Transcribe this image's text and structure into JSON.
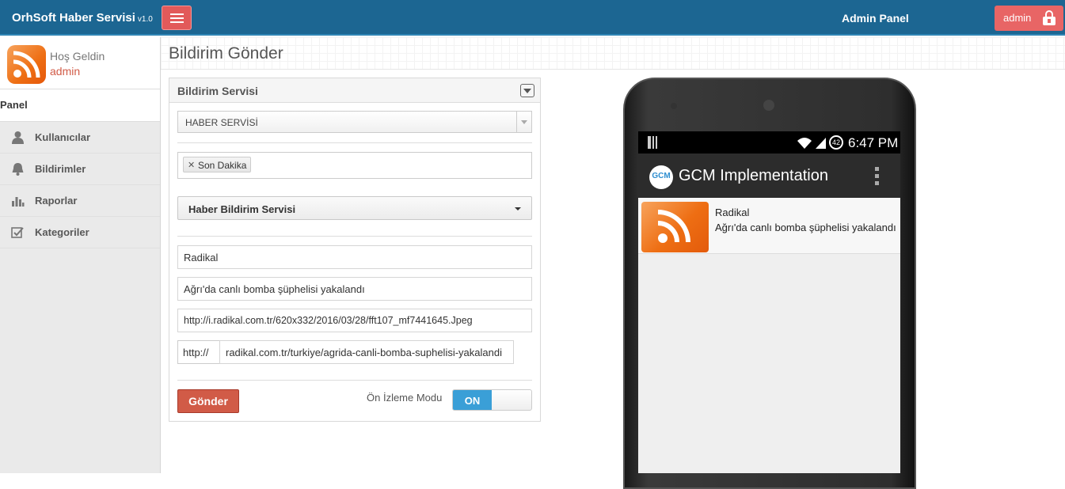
{
  "navbar": {
    "brand": "OrhSoft Haber Servisi",
    "version": "v1.0",
    "center_title": "Admin Panel",
    "user_button": "admin",
    "accent": "#1c6692"
  },
  "sidebar": {
    "greeting": "Hoş Geldin",
    "username": "admin",
    "section": "Panel",
    "items": [
      {
        "label": "Kullanıcılar",
        "icon": "user-icon"
      },
      {
        "label": "Bildirimler",
        "icon": "bell-icon"
      },
      {
        "label": "Raporlar",
        "icon": "bar-chart-icon"
      },
      {
        "label": "Kategoriler",
        "icon": "checkbox-icon"
      }
    ]
  },
  "page": {
    "title": "Bildirim Gönder"
  },
  "form": {
    "widget_title": "Bildirim Servisi",
    "service_select": "HABER SERVİSİ",
    "tag": "Son Dakika",
    "dropdown": "Haber Bildirim Servisi",
    "source": "Radikal",
    "headline": "Ağrı'da canlı bomba şüphelisi yakalandı",
    "image_url": "http://i.radikal.com.tr/620x332/2016/03/28/fft107_mf7441645.Jpeg",
    "link_prefix": "http://",
    "link": "radikal.com.tr/turkiye/agrida-canli-bomba-suphelisi-yakalandi",
    "send_button": "Gönder",
    "preview_label": "Ön İzleme Modu",
    "preview_toggle": "ON"
  },
  "phone": {
    "time": "6:47 PM",
    "battery": "42",
    "app_logo": "GCM",
    "app_title": "GCM Implementation",
    "notification_title": "Radikal",
    "notification_text": "Ağrı'da canlı bomba şüphelisi yakalandı"
  }
}
